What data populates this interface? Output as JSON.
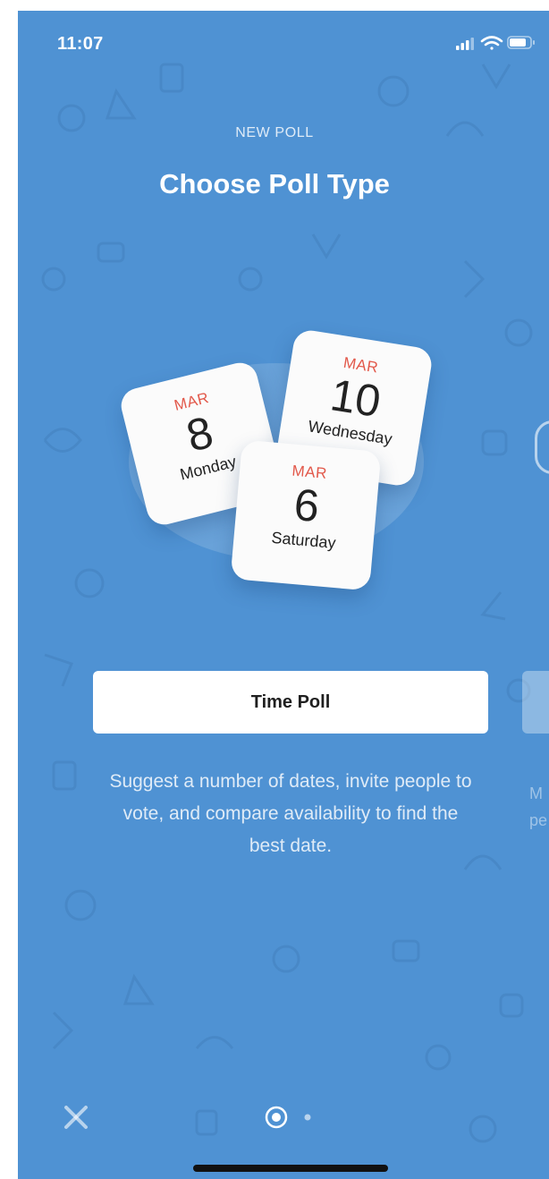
{
  "status_bar": {
    "time": "11:07"
  },
  "header": {
    "subtitle": "NEW POLL",
    "title": "Choose Poll Type"
  },
  "cards": [
    {
      "month": "MAR",
      "day": "8",
      "weekday": "Monday"
    },
    {
      "month": "MAR",
      "day": "10",
      "weekday": "Wednesday"
    },
    {
      "month": "MAR",
      "day": "6",
      "weekday": "Saturday"
    }
  ],
  "primary_button": {
    "label": "Time Poll"
  },
  "description": "Suggest a number of dates, invite people to vote, and compare availability to find the best date.",
  "peek_description": "M\npe",
  "pager": {
    "current_page": 1,
    "total_pages": 2
  },
  "icons": {
    "close": "close-icon",
    "signal": "signal-icon",
    "wifi": "wifi-icon",
    "battery": "battery-icon"
  },
  "colors": {
    "background": "#4f92d3",
    "month_accent": "#e2584a",
    "button": "#ffffff"
  }
}
